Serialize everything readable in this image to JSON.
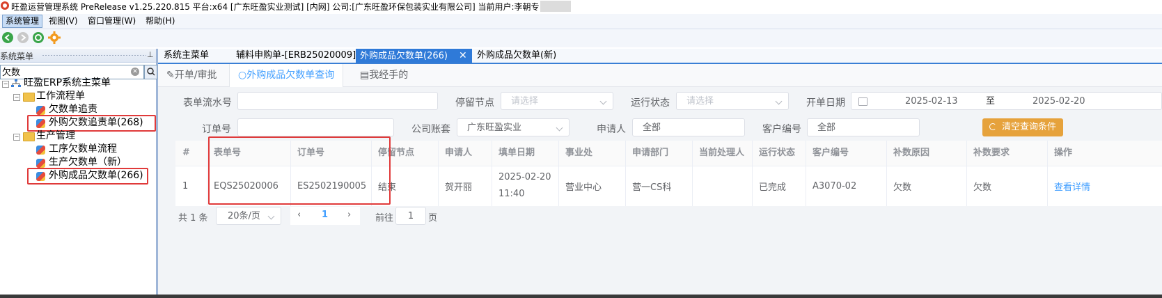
{
  "window": {
    "title": "旺盈运营管理系统 PreRelease v1.25.220.815 平台:x64  [广东旺盈实业测试] [内网] 公司:[广东旺盈环保包装实业有限公司] 当前用户:李朝专"
  },
  "menubar": {
    "items": [
      "系统管理",
      "视图(V)",
      "窗口管理(W)",
      "帮助(H)"
    ]
  },
  "toolbar": {
    "icons": [
      "back-icon",
      "forward-icon",
      "refresh-icon",
      "settings-icon"
    ]
  },
  "left_panel": {
    "title": "系统菜单",
    "search_value": "欠数",
    "tree": {
      "root": "旺盈ERP系统主菜单",
      "groups": [
        {
          "label": "工作流程单",
          "items": [
            "欠数单追责",
            "外购欠数追责单(268)"
          ]
        },
        {
          "label": "生产管理",
          "items": [
            "工序欠数单流程",
            "生产欠数单（新）",
            "外购成品欠数单(266)"
          ]
        }
      ]
    }
  },
  "doc_tabs": [
    {
      "label": "系统主菜单",
      "active": false
    },
    {
      "label": "辅料申购单-[ERB25020009]",
      "active": false
    },
    {
      "label": "外购成品欠数单(266)",
      "active": true
    },
    {
      "label": "外购成品欠数单(新)",
      "active": false
    }
  ],
  "sub_tabs": [
    {
      "label": "开单/审批",
      "icon": "edit-icon"
    },
    {
      "label": "外购成品欠数单查询",
      "icon": "search-icon"
    },
    {
      "label": "我经手的",
      "icon": "document-icon"
    }
  ],
  "filters": {
    "row1": {
      "serial_label": "表单流水号",
      "serial_value": "",
      "node_label": "停留节点",
      "node_placeholder": "请选择",
      "status_label": "运行状态",
      "status_placeholder": "请选择",
      "date_label": "开单日期",
      "date_start": "2025-02-13",
      "date_sep": "至",
      "date_end": "2025-02-20"
    },
    "row2": {
      "order_label": "订单号",
      "order_value": "",
      "company_label": "公司账套",
      "company_value": "广东旺盈实业",
      "applicant_label": "申请人",
      "applicant_value": "全部",
      "customer_label": "客户编号",
      "customer_value": "全部"
    },
    "reset_label": "清空查询条件"
  },
  "table": {
    "headers": [
      "#",
      "表单号",
      "订单号",
      "停留节点",
      "申请人",
      "填单日期",
      "事业处",
      "申请部门",
      "当前处理人",
      "运行状态",
      "客户编号",
      "补数原因",
      "补数要求",
      "操作"
    ],
    "rows": [
      [
        "1",
        "EQS25020006",
        "ES2502190005",
        "结束",
        "贺开丽",
        "2025-02-20 11:40",
        "营业中心",
        "营一CS科",
        "",
        "已完成",
        "A3070-02",
        "欠数",
        "欠数",
        "查看详情"
      ]
    ]
  },
  "pagination": {
    "total_text": "共 1 条",
    "page_size": "20条/页",
    "current_page": "1",
    "goto_prefix": "前往",
    "goto_value": "1",
    "goto_suffix": "页"
  },
  "colors": {
    "accent_blue": "#2f7ad8",
    "link_blue": "#409eff",
    "reset_orange": "#e6a23c",
    "annotation_red": "#e03a3a"
  }
}
